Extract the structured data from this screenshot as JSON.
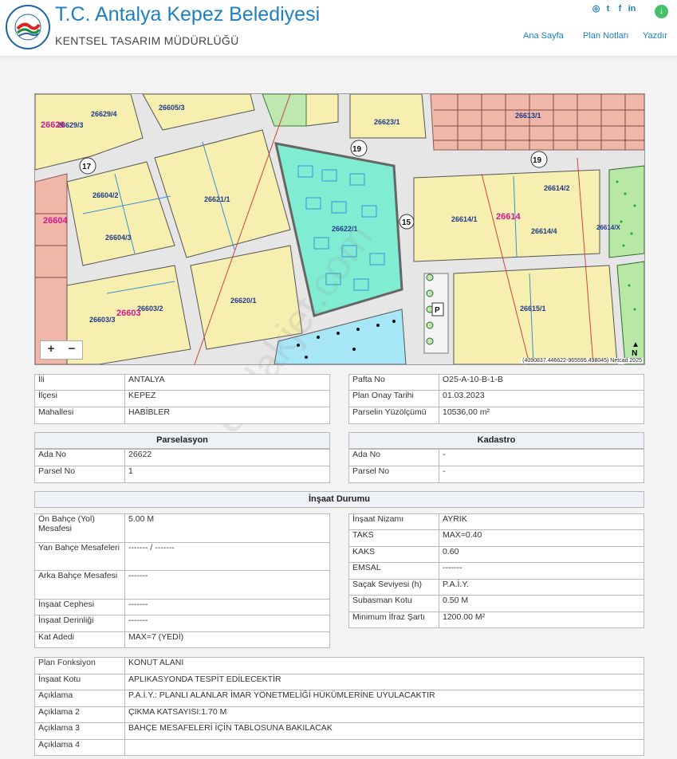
{
  "header": {
    "logo_text": "KEPEZ BELEDİYESİ",
    "title": "T.C. Antalya Kepez Belediyesi",
    "subtitle": "KENTSEL TASARIM MÜDÜRLÜĞÜ",
    "nav": [
      "Ana Sayfa",
      "Plan Notları",
      "Yazdır"
    ],
    "social_icons": [
      "instagram-icon",
      "twitter-icon",
      "facebook-icon",
      "linkedin-icon"
    ],
    "download_icon": "download-icon"
  },
  "map": {
    "labels": {
      "p1": "26629/4",
      "p2": "26605/3",
      "p3": "26629/3",
      "p4": "26620",
      "p5": "26623/1",
      "p6": "26613/1",
      "p7": "26604/2",
      "p8": "26621/1",
      "p9": "26622/1",
      "p10": "26614/2",
      "p11": "26614/1",
      "p12": "26614",
      "p13": "26604",
      "p14": "26604/3",
      "p15": "26614/4",
      "p16": "26620/1",
      "p17": "26603/2",
      "p18": "26603/3",
      "p19": "26615/1",
      "p20": "26603",
      "p21": "26614/X",
      "road17": "17",
      "road19a": "19",
      "road19b": "19",
      "road15": "15",
      "parking": "P"
    },
    "zoom_in": "+",
    "zoom_out": "−",
    "coord_text": "(4090837.446622-965595.498045) Netcad 2025",
    "north": "N"
  },
  "watermark": "emlakjet.com",
  "location": {
    "left": [
      {
        "k": "İli",
        "v": "ANTALYA"
      },
      {
        "k": "İlçesi",
        "v": "KEPEZ"
      },
      {
        "k": "Mahallesi",
        "v": "HABİBLER"
      }
    ],
    "right": [
      {
        "k": "Pafta No",
        "v": "O25-A-10-B-1-B"
      },
      {
        "k": "Plan Onay Tarihi",
        "v": "01.03.2023"
      },
      {
        "k": "Parselin Yüzölçümü",
        "v": "10536,00 m²"
      }
    ]
  },
  "parselasyon": {
    "title": "Parselasyon",
    "rows": [
      {
        "k": "Ada No",
        "v": "26622"
      },
      {
        "k": "Parsel No",
        "v": "1"
      }
    ]
  },
  "kadastro": {
    "title": "Kadastro",
    "rows": [
      {
        "k": "Ada No",
        "v": "-"
      },
      {
        "k": "Parsel No",
        "v": "-"
      }
    ]
  },
  "insaat": {
    "title": "İnşaat Durumu",
    "left": [
      {
        "k": "Ön Bahçe (Yol) Mesafesi",
        "v": "5.00 M"
      },
      {
        "k": "Yan Bahçe Mesafeleri",
        "v": "------- / -------"
      },
      {
        "k": "Arka Bahçe Mesafesi",
        "v": "-------"
      },
      {
        "k": "İnşaat Cephesi",
        "v": "-------"
      },
      {
        "k": "İnşaat Derinliği",
        "v": "-------"
      },
      {
        "k": "Kat Adedi",
        "v": "MAX=7 (YEDİ)"
      }
    ],
    "right": [
      {
        "k": "İnşaat Nizamı",
        "v": "AYRIK"
      },
      {
        "k": "TAKS",
        "v": "MAX=0.40"
      },
      {
        "k": "KAKS",
        "v": "0.60"
      },
      {
        "k": "EMSAL",
        "v": "-------"
      },
      {
        "k": "Saçak Seviyesi (h)",
        "v": "P.A.İ.Y."
      },
      {
        "k": "Subasman Kotu",
        "v": "0.50 M"
      },
      {
        "k": "Minimum İfraz Şartı",
        "v": "1200.00 M²"
      }
    ]
  },
  "plan": [
    {
      "k": "Plan Fonksiyon",
      "v": "KONUT ALANI"
    },
    {
      "k": "İnşaat Kotu",
      "v": "APLIKASYONDA TESPİT EDİLECEKTİR"
    },
    {
      "k": "Açıklama",
      "v": "P.A.İ.Y.: PLANLI ALANLAR İMAR YÖNETMELİĞİ HÜKÜMLERİNE UYULACAKTIR"
    },
    {
      "k": "Açıklama 2",
      "v": "ÇIKMA KATSAYISI:1.70 M"
    },
    {
      "k": "Açıklama 3",
      "v": "BAHÇE MESAFELERİ İÇİN TABLOSUNA BAKILACAK"
    },
    {
      "k": "Açıklama 4",
      "v": ""
    }
  ]
}
